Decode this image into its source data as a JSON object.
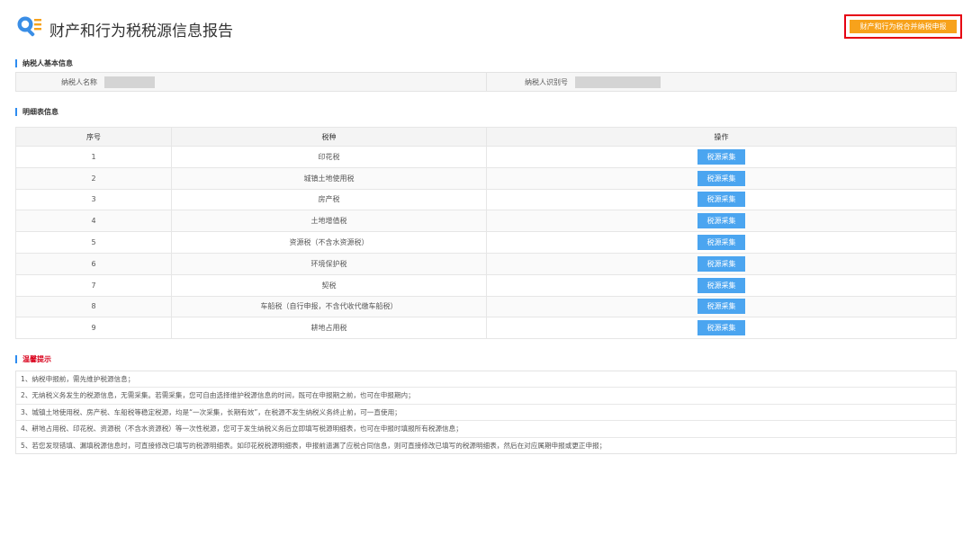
{
  "header": {
    "title": "财产和行为税税源信息报告",
    "merge_button": "财产和行为税合并纳税申报"
  },
  "colors": {
    "accent_blue": "#2d8cf0",
    "orange_button": "#f7a21b",
    "highlight_red": "#e60012",
    "collect_button": "#4ba5f0"
  },
  "basic_info": {
    "section_title": "纳税人基本信息",
    "name_label": "纳税人名称",
    "id_label": "纳税人识别号"
  },
  "detail": {
    "section_title": "明细表信息",
    "columns": [
      "序号",
      "税种",
      "操作"
    ],
    "action_label": "税源采集",
    "rows": [
      {
        "no": "1",
        "tax": "印花税"
      },
      {
        "no": "2",
        "tax": "城镇土地使用税"
      },
      {
        "no": "3",
        "tax": "房产税"
      },
      {
        "no": "4",
        "tax": "土地增值税"
      },
      {
        "no": "5",
        "tax": "资源税（不含水资源税）"
      },
      {
        "no": "6",
        "tax": "环境保护税"
      },
      {
        "no": "7",
        "tax": "契税"
      },
      {
        "no": "8",
        "tax": "车船税（自行申报，不含代收代缴车船税）"
      },
      {
        "no": "9",
        "tax": "耕地占用税"
      }
    ]
  },
  "tips": {
    "section_title": "温馨提示",
    "items": [
      "1、纳税申报前，需先维护税源信息；",
      "2、无纳税义务发生的税源信息，无需采集。若需采集，您可自由选择维护税源信息的时间，既可在申报期之前，也可在申报期内；",
      "3、城镇土地使用税、房产税、车船税等稳定税源，均是“一次采集，长期有效”，在税源不发生纳税义务终止前，可一直使用；",
      "4、耕地占用税、印花税、资源税（不含水资源税）等一次性税源，您可于发生纳税义务后立即填写税源明细表，也可在申报时填报所有税源信息；",
      "5、若您发现错填、漏填税源信息时，可直接修改已填写的税源明细表。如印花税税源明细表，申报前遗漏了应税合同信息，则可直接修改已填写的税源明细表，然后在对应属期申报或更正申报；"
    ]
  }
}
